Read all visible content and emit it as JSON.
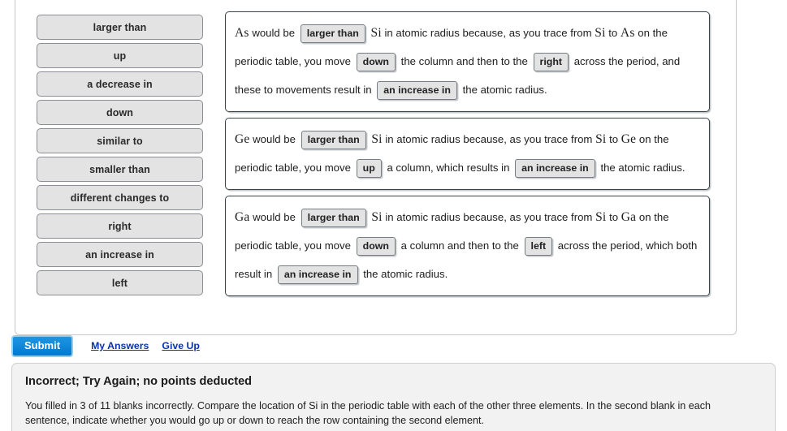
{
  "word_bank": {
    "items": [
      {
        "label": "larger than"
      },
      {
        "label": "up"
      },
      {
        "label": "a decrease in"
      },
      {
        "label": "down"
      },
      {
        "label": "similar to"
      },
      {
        "label": "smaller than"
      },
      {
        "label": "different changes to"
      },
      {
        "label": "right"
      },
      {
        "label": "an increase in"
      },
      {
        "label": "left"
      }
    ]
  },
  "sentences": [
    {
      "id": "sentence-as",
      "parts": {
        "el_start": "As",
        "t1": "would be",
        "blank1": "larger than",
        "el_mid": "Si",
        "t2": "in atomic radius because, as you trace from",
        "el_from": "Si",
        "t3": "to",
        "el_to": "As",
        "t4": "on the periodic table, you move",
        "blank2": "down",
        "t5": "the column and then to the",
        "blank3": "right",
        "t6": "across the period, and these to movements result in",
        "blank4": "an increase in",
        "t7": "the atomic radius."
      }
    },
    {
      "id": "sentence-ge",
      "parts": {
        "el_start": "Ge",
        "t1": "would be",
        "blank1": "larger than",
        "el_mid": "Si",
        "t2": "in atomic radius because, as you trace from",
        "el_from": "Si",
        "t3": "to",
        "el_to": "Ge",
        "t4": "on the periodic table, you move",
        "blank2": "up",
        "t5": "a column, which results in",
        "blank3": "an increase in",
        "t6": "the atomic radius."
      }
    },
    {
      "id": "sentence-ga",
      "parts": {
        "el_start": "Ga",
        "t1": "would be",
        "blank1": "larger than",
        "el_mid": "Si",
        "t2": "in atomic radius because, as you trace from",
        "el_from": "Si",
        "t3": "to",
        "el_to": "Ga",
        "t4": "on the periodic table, you move",
        "blank2": "down",
        "t5": "a column and then to the",
        "blank3": "left",
        "t6": "across the period, which both result in",
        "blank4": "an increase in",
        "t7": "the atomic radius."
      }
    }
  ],
  "actions": {
    "submit_label": "Submit",
    "my_answers_label": "My Answers",
    "give_up_label": "Give Up"
  },
  "feedback": {
    "title": "Incorrect; Try Again; no points deducted",
    "body": "You filled in 3 of 11 blanks incorrectly. Compare the location of Si in the periodic table with each of the other three elements. In the second blank in each sentence, indicate whether you would go up or down to reach the row containing the second element."
  },
  "colors": {
    "submit_blue": "#0a83d6",
    "link_blue": "#0b33a8",
    "chip_gray": "#e3e3e3",
    "panel_gray": "#f2f2f2"
  }
}
